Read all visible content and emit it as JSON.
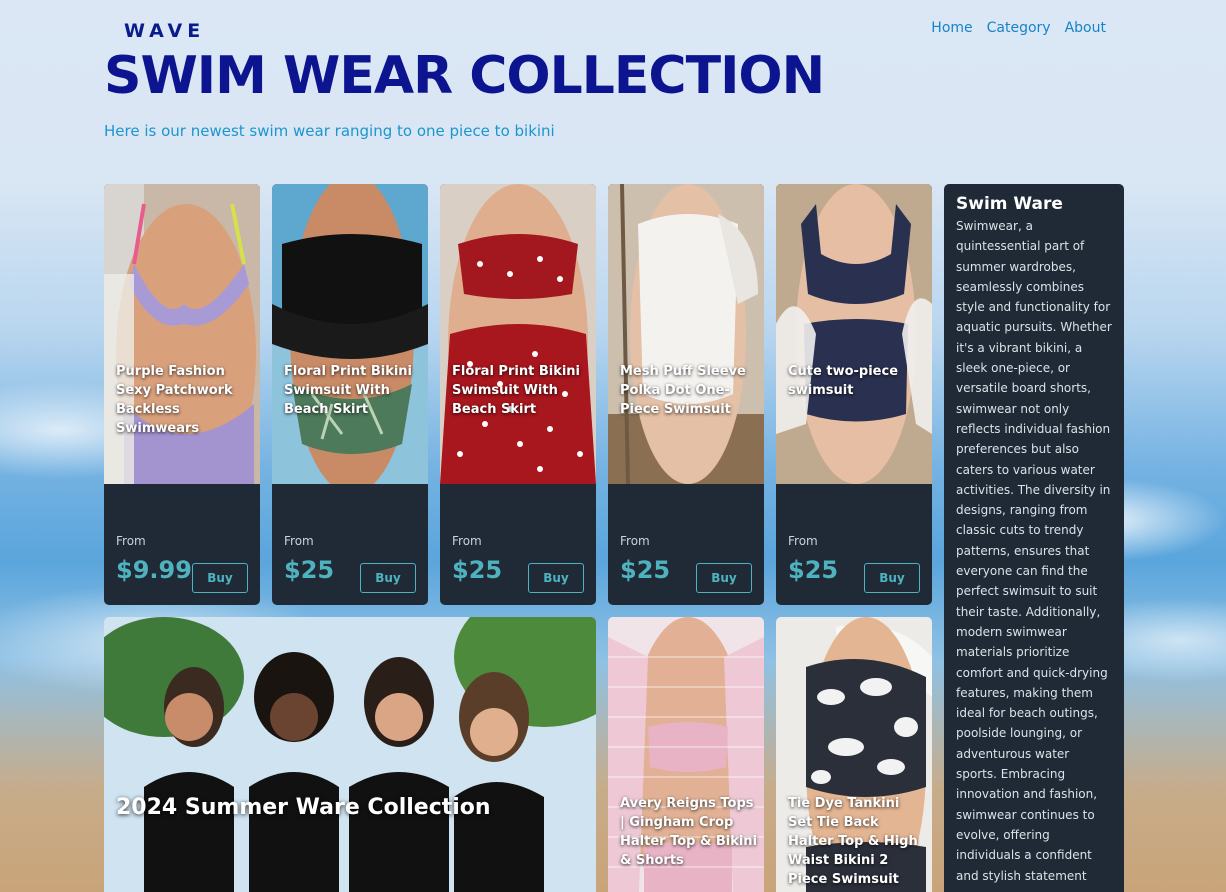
{
  "brand": "WAVE",
  "nav": {
    "home": "Home",
    "category": "Category",
    "about": "About"
  },
  "hero": {
    "title": "SWIM WEAR COLLECTION",
    "subtitle": "Here is our newest swim wear ranging to one piece to bikini"
  },
  "products": [
    {
      "name": "Purple Fashion Sexy Patchwork Backless Swimwears",
      "from_label": "From",
      "price": "$9.99",
      "buy_label": "Buy"
    },
    {
      "name": "Floral Print Bikini Swimsuit With Beach Skirt",
      "from_label": "From",
      "price": "$25",
      "buy_label": "Buy"
    },
    {
      "name": "Floral Print Bikini Swimsuit With Beach Skirt",
      "from_label": "From",
      "price": "$25",
      "buy_label": "Buy"
    },
    {
      "name": "Mesh Puff Sleeve Polka Dot One-Piece Swimsuit",
      "from_label": "From",
      "price": "$25",
      "buy_label": "Buy"
    },
    {
      "name": "Cute two-piece swimsuit",
      "from_label": "From",
      "price": "$25",
      "buy_label": "Buy"
    }
  ],
  "info": {
    "title": "Swim Ware",
    "body": "Swimwear, a quintessential part of summer wardrobes, seamlessly combines style and functionality for aquatic pursuits. Whether it's a vibrant bikini, a sleek one-piece, or versatile board shorts, swimwear not only reflects individual fashion preferences but also caters to various water activities. The diversity in designs, ranging from classic cuts to trendy patterns, ensures that everyone can find the perfect swimsuit to suit their taste. Additionally, modern swimwear materials prioritize comfort and quick-drying features, making them ideal for beach outings, poolside lounging, or adventurous water sports. Embracing innovation and fashion, swimwear continues to evolve, offering individuals a confident and stylish statement"
  },
  "feature": {
    "title": "2024 Summer Ware Collection"
  },
  "bottom_products": [
    {
      "name": "Avery Reigns Tops | Gingham Crop Halter Top & Bikini & Shorts"
    },
    {
      "name": "Tie Dye Tankini Set Tie Back Halter Top & High Waist Bikini 2 Piece Swimsuit"
    }
  ],
  "colors": {
    "brand_navy": "#0c148f",
    "accent_blue": "#1b96cf",
    "card_bg": "#1f2a36",
    "price_teal": "#4fb3bf"
  }
}
